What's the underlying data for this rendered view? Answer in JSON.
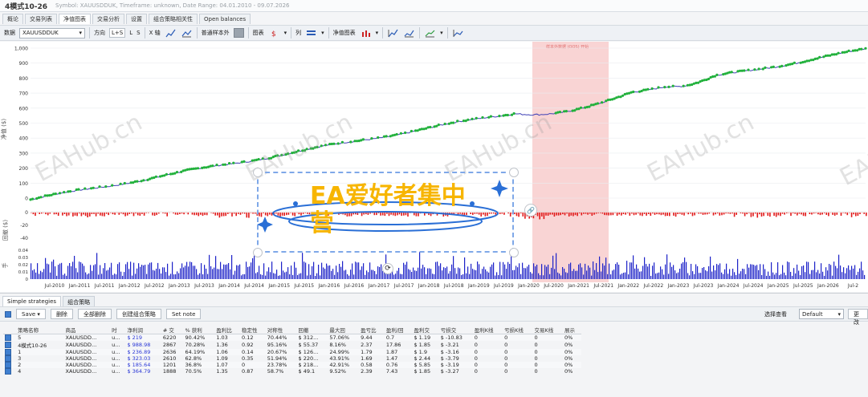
{
  "window": {
    "title": "4模式10-26",
    "subtitle": "Symbol: XAUUSDDUK, Timeframe: unknown, Date Range: 04.01.2010 - 09.07.2026"
  },
  "tabs": [
    "概论",
    "交易列表",
    "净值图表",
    "交易分析",
    "设置",
    "组合策略相关性",
    "Open balances"
  ],
  "toolbar": {
    "data_label": "数据",
    "data_value": "XAUUSDDUK",
    "direction_label": "方向",
    "direction_options": [
      "L+S",
      "L",
      "S"
    ],
    "x_axis_label": "X 轴",
    "report_label": "普通样本外",
    "chart_label": "图表",
    "column_label": "列",
    "compare_label": "净值图表"
  },
  "chart": {
    "y_ticks_equity": [
      "1,000",
      "900",
      "800",
      "700",
      "600",
      "500",
      "400",
      "300",
      "200",
      "100",
      "0"
    ],
    "y_ticks_dd": [
      "0",
      "-20",
      "-40"
    ],
    "y_ticks_vol": [
      "0.04",
      "0.03",
      "0.02",
      "0.01",
      "0"
    ],
    "x_ticks": [
      "Jul-2010",
      "Jan-2011",
      "Jul-2011",
      "Jan-2012",
      "Jul-2012",
      "Jan-2013",
      "Jul-2013",
      "Jan-2014",
      "Jul-2014",
      "Jan-2015",
      "Jul-2015",
      "Jan-2016",
      "Jul-2016",
      "Jan-2017",
      "Jul-2017",
      "Jan-2018",
      "Jul-2018",
      "Jan-2019",
      "Jul-2019",
      "Jan-2020",
      "Jul-2020",
      "Jan-2021",
      "Jul-2021",
      "Jan-2022",
      "Jul-2022",
      "Jan-2023",
      "Jul-2023",
      "Jan-2024",
      "Jul-2024",
      "Jan-2025",
      "Jul-2025",
      "Jan-2026",
      "Jul-2"
    ],
    "equity_axis_label": "净值 ($)",
    "dd_axis_label": "回撤 ($)",
    "vol_axis_label": "手",
    "oos_label": "样本外数据 (OOS) 开始"
  },
  "watermark": "EAHub.cn",
  "overlay_brand": "EA爱好者集中营",
  "bottom": {
    "tabs": [
      "Simple strategies",
      "组合策略"
    ],
    "actions": [
      "Save",
      "删除",
      "全部删除",
      "创建组合策略",
      "Set note"
    ],
    "view_label": "选择查看",
    "view_value": "Default",
    "cut_label": "更改"
  },
  "table": {
    "headers": [
      "策略名称",
      "",
      "商品",
      "时",
      "净利润",
      "# 交",
      "% 获利",
      "盈利比",
      "稳定性",
      "对称性",
      "回撤",
      "最大回",
      "盈亏比",
      "盈利/回",
      "盈利交",
      "亏损交",
      "盈利K线",
      "亏损K线",
      "交易K线",
      "展示"
    ],
    "rows": [
      [
        "5",
        "",
        "XAUUSDD...",
        "u...",
        "$ 219",
        "6220",
        "90.42%",
        "1.03",
        "0.12",
        "70.44%",
        "$ 312...",
        "57.06%",
        "9.44",
        "0.7",
        "$ 1.19",
        "$ -10.83",
        "0",
        "0",
        "0",
        "0%"
      ],
      [
        "4模式10-26",
        "",
        "XAUUSDD...",
        "u...",
        "$ 988.98",
        "2867",
        "70.28%",
        "1.36",
        "0.92",
        "95.16%",
        "$ 55.37",
        "8.16%",
        "2.37",
        "17.86",
        "$ 1.85",
        "$ -3.21",
        "0",
        "0",
        "0",
        "0%"
      ],
      [
        "1",
        "",
        "XAUUSDD...",
        "u...",
        "$ 236.89",
        "2636",
        "64.19%",
        "1.06",
        "0.14",
        "20.67%",
        "$ 126...",
        "24.99%",
        "1.79",
        "1.87",
        "$ 1.9",
        "$ -3.16",
        "0",
        "0",
        "0",
        "0%"
      ],
      [
        "3",
        "",
        "XAUUSDD...",
        "u...",
        "$ 323.03",
        "2610",
        "62.8%",
        "1.09",
        "0.35",
        "51.94%",
        "$ 220...",
        "43.91%",
        "1.69",
        "1.47",
        "$ 2.44",
        "$ -3.79",
        "0",
        "0",
        "0",
        "0%"
      ],
      [
        "2",
        "",
        "XAUUSDD...",
        "u...",
        "$ 185.64",
        "1201",
        "36.8%",
        "1.07",
        "0",
        "23.78%",
        "$ 218...",
        "42.91%",
        "0.58",
        "0.76",
        "$ 5.85",
        "$ -3.19",
        "0",
        "0",
        "0",
        "0%"
      ],
      [
        "4",
        "",
        "XAUUSDD...",
        "u...",
        "$ 364.79",
        "1888",
        "70.5%",
        "1.35",
        "0.87",
        "58.7%",
        "$ 49.1",
        "9.52%",
        "2.39",
        "7.43",
        "$ 1.85",
        "$ -3.27",
        "0",
        "0",
        "0",
        "0%"
      ]
    ]
  },
  "colors": {
    "equity_line": "#3d3fb5",
    "equity_up": "#22b13c",
    "drawdown": "#e01818",
    "volume": "#1c22c8",
    "oos_band": "#f9d4d4",
    "brand": "#f7b500",
    "overlay_border": "#7fa8e8"
  }
}
